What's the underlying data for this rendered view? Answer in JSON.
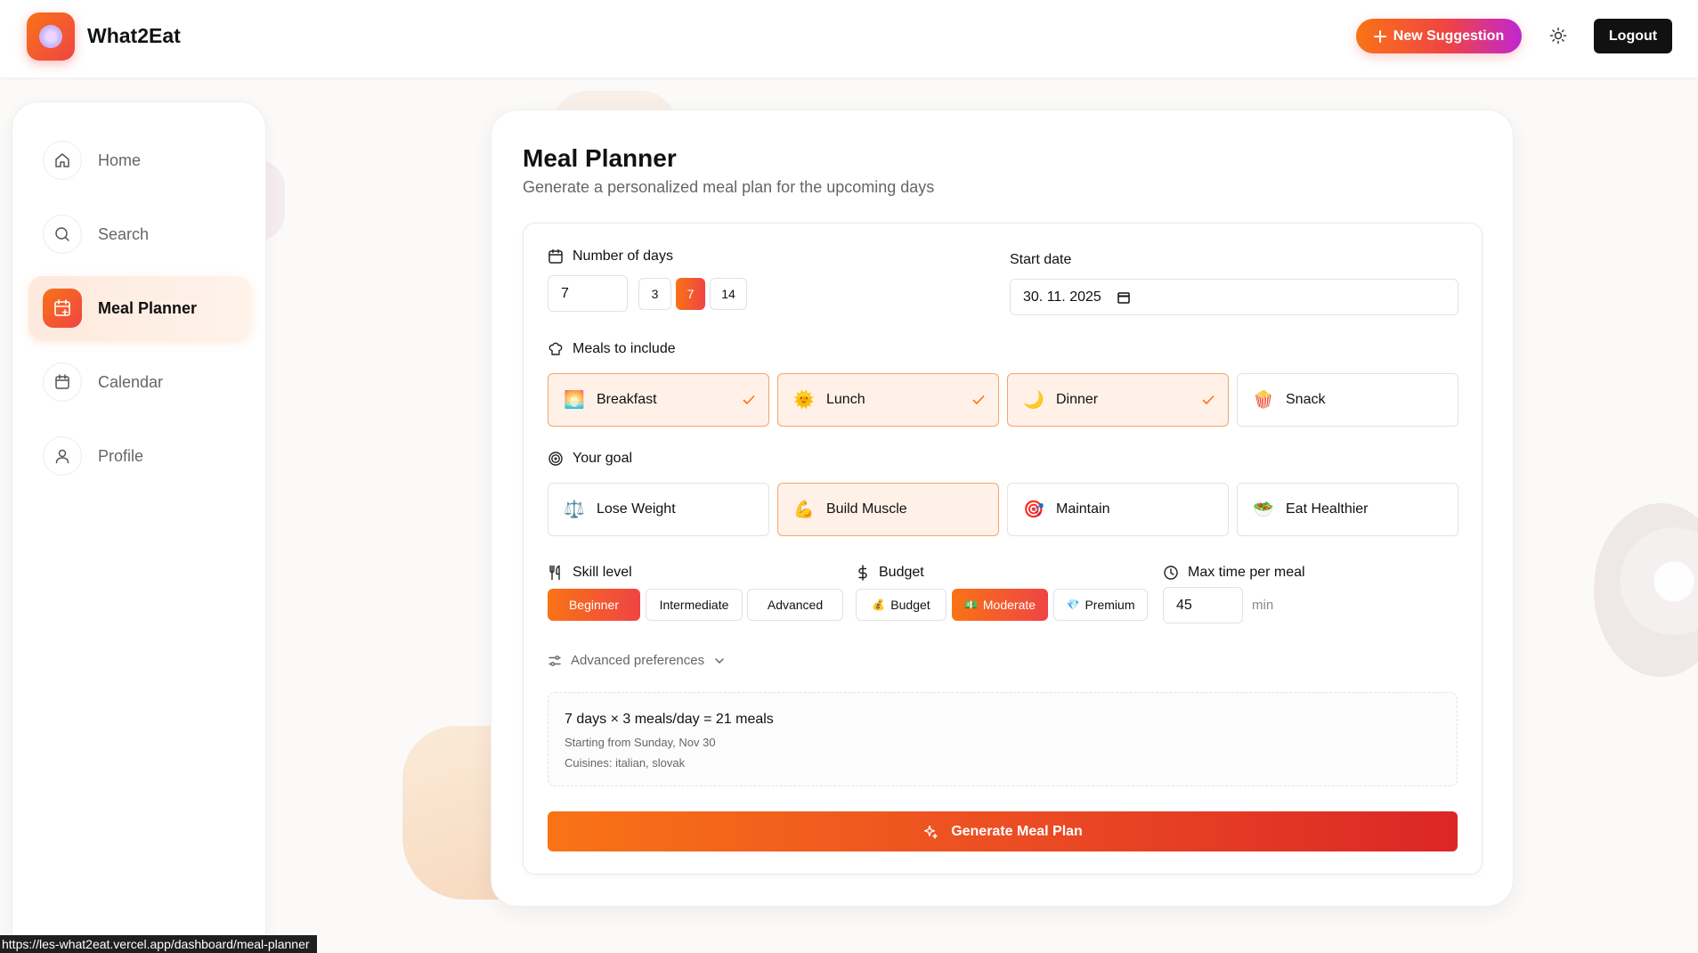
{
  "app": {
    "title": "What2Eat"
  },
  "header": {
    "new_suggestion_label": "New Suggestion",
    "logout_label": "Logout"
  },
  "sidebar": {
    "items": [
      {
        "label": "Home",
        "icon": "home-icon"
      },
      {
        "label": "Search",
        "icon": "search-icon"
      },
      {
        "label": "Meal Planner",
        "icon": "calendar-plus-icon",
        "active": true
      },
      {
        "label": "Calendar",
        "icon": "calendar-icon"
      },
      {
        "label": "Profile",
        "icon": "user-icon"
      }
    ]
  },
  "planner": {
    "title": "Meal Planner",
    "subtitle": "Generate a personalized meal plan for the upcoming days",
    "days": {
      "label": "Number of days",
      "value": "7",
      "presets": [
        "3",
        "7",
        "14"
      ],
      "selected": "7"
    },
    "start_date": {
      "label": "Start date",
      "value": "30. 11. 2025"
    },
    "meals": {
      "label": "Meals to include",
      "options": [
        {
          "label": "Breakfast",
          "emoji": "🌅",
          "selected": true
        },
        {
          "label": "Lunch",
          "emoji": "🌞",
          "selected": true
        },
        {
          "label": "Dinner",
          "emoji": "🌙",
          "selected": true
        },
        {
          "label": "Snack",
          "emoji": "🍿",
          "selected": false
        }
      ]
    },
    "goal": {
      "label": "Your goal",
      "options": [
        {
          "label": "Lose Weight",
          "emoji": "⚖️",
          "selected": false
        },
        {
          "label": "Build Muscle",
          "emoji": "💪",
          "selected": true
        },
        {
          "label": "Maintain",
          "emoji": "🎯",
          "selected": false
        },
        {
          "label": "Eat Healthier",
          "emoji": "🥗",
          "selected": false
        }
      ]
    },
    "skill": {
      "label": "Skill level",
      "options": [
        "Beginner",
        "Intermediate",
        "Advanced"
      ],
      "selected": "Beginner"
    },
    "budget": {
      "label": "Budget",
      "options": [
        {
          "label": "Budget",
          "emoji": "💰"
        },
        {
          "label": "Moderate",
          "emoji": "💵"
        },
        {
          "label": "Premium",
          "emoji": "💎"
        }
      ],
      "selected": "Moderate"
    },
    "max_time": {
      "label": "Max time per meal",
      "value": "45",
      "unit": "min"
    },
    "advanced_label": "Advanced preferences",
    "summary": {
      "line1": "7 days × 3 meals/day = 21 meals",
      "line2": "Starting from Sunday, Nov 30",
      "line3": "Cuisines: italian, slovak"
    },
    "generate_label": "Generate Meal Plan"
  },
  "status_bar": {
    "url": "https://les-what2eat.vercel.app/dashboard/meal-planner"
  },
  "colors": {
    "accent_orange": "#f97316",
    "accent_red": "#ef4444",
    "selected_bg": "#fff1e8"
  }
}
